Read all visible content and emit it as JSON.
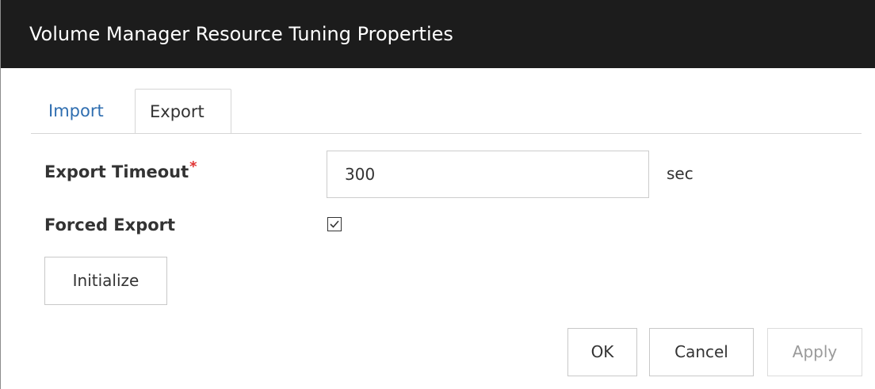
{
  "window": {
    "title": "Volume Manager Resource Tuning Properties"
  },
  "tabs": [
    {
      "label": "Import",
      "active": false
    },
    {
      "label": "Export",
      "active": true
    }
  ],
  "form": {
    "export_timeout": {
      "label": "Export Timeout",
      "required_mark": "*",
      "value": "300",
      "unit": "sec"
    },
    "forced_export": {
      "label": "Forced Export",
      "checked": true
    }
  },
  "buttons": {
    "initialize": "Initialize",
    "ok": "OK",
    "cancel": "Cancel",
    "apply": "Apply"
  },
  "colors": {
    "titlebar": "#1c1c1c",
    "tab_link": "#2f6eb0",
    "required": "#e03333"
  }
}
